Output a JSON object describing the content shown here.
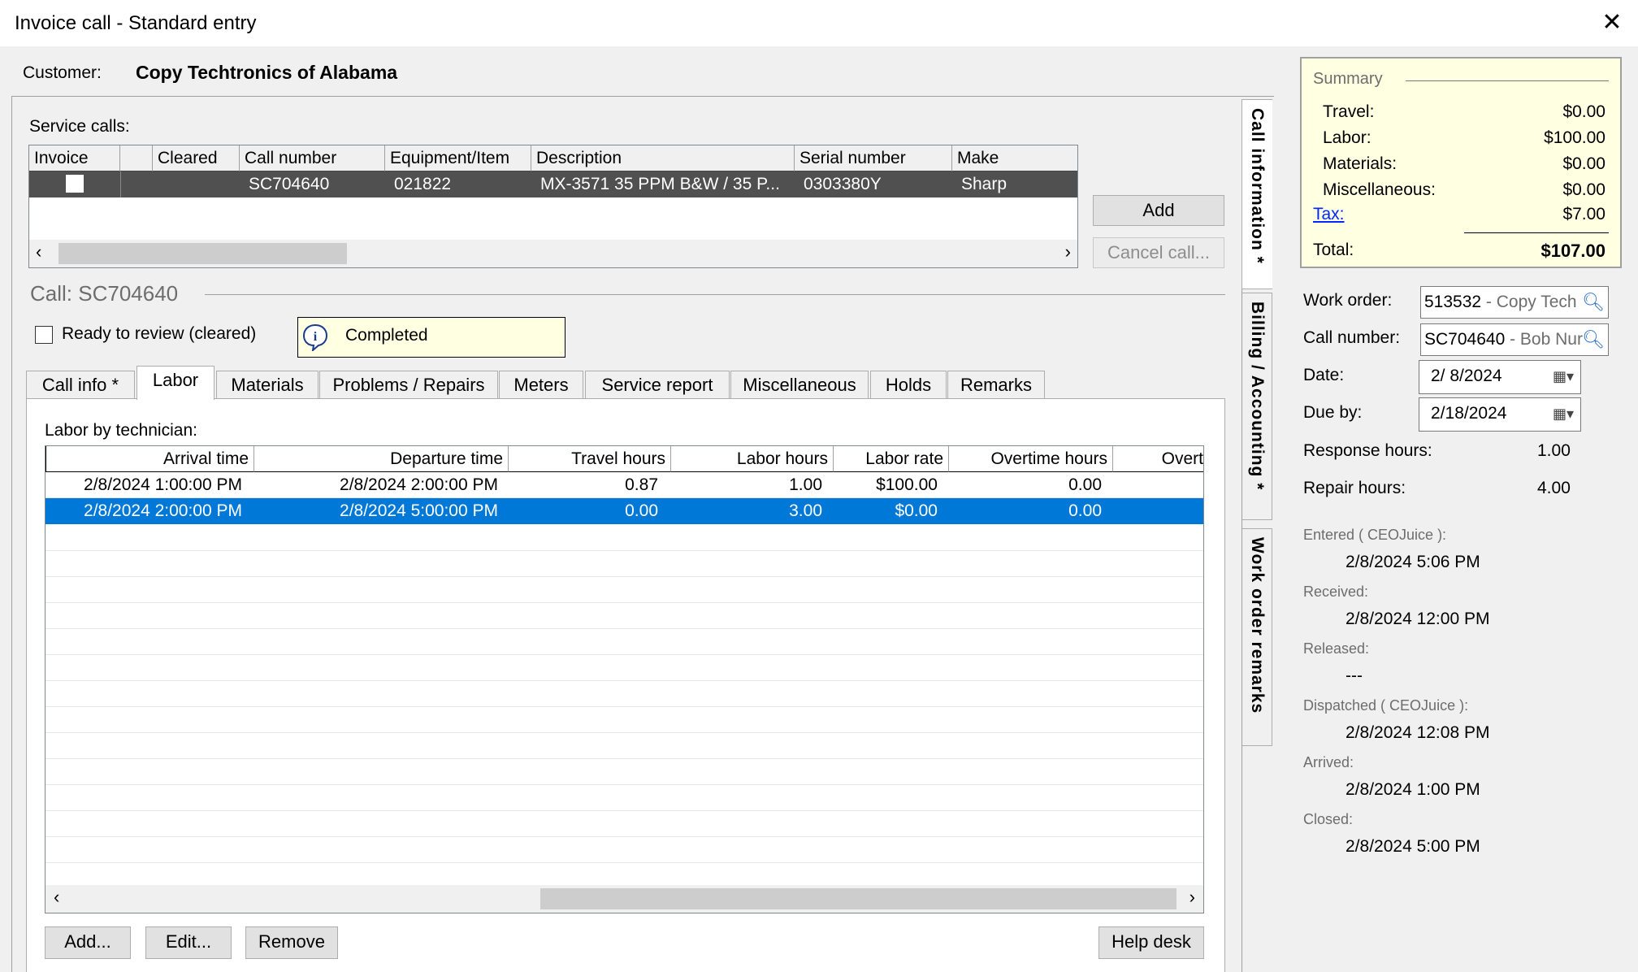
{
  "window": {
    "title": "Invoice call - Standard entry",
    "close": "✕"
  },
  "customer": {
    "label": "Customer:",
    "name": "Copy Techtronics of Alabama"
  },
  "service_calls": {
    "label": "Service calls:",
    "columns": [
      "Invoice",
      "",
      "Cleared",
      "Call number",
      "Equipment/Item",
      "Description",
      "Serial number",
      "Make"
    ],
    "row": {
      "call_number": "SC704640",
      "equipment": "021822",
      "description": "MX-3571 35 PPM B&W / 35 P...",
      "serial": "0303380Y",
      "make": "Sharp"
    },
    "add": "Add",
    "cancel": "Cancel call..."
  },
  "call": {
    "title": "Call: SC704640",
    "ready_label": "Ready to review (cleared)",
    "status": "Completed"
  },
  "tabs": [
    "Call info *",
    "Labor",
    "Materials",
    "Problems / Repairs",
    "Meters",
    "Service report",
    "Miscellaneous",
    "Holds",
    "Remarks"
  ],
  "active_tab": "Labor",
  "side_tabs": [
    "Call information *",
    "Billing / Accounting *",
    "Work order remarks"
  ],
  "labor": {
    "label": "Labor by technician:",
    "columns": [
      "Arrival time",
      "Departure time",
      "Travel hours",
      "Labor hours",
      "Labor rate",
      "Overtime hours",
      "Overt"
    ],
    "rows": [
      [
        "2/8/2024 1:00:00 PM",
        "2/8/2024 2:00:00 PM",
        "0.87",
        "1.00",
        "$100.00",
        "0.00"
      ],
      [
        "2/8/2024 2:00:00 PM",
        "2/8/2024 5:00:00 PM",
        "0.00",
        "3.00",
        "$0.00",
        "0.00"
      ]
    ],
    "buttons": {
      "add": "Add...",
      "edit": "Edit...",
      "remove": "Remove",
      "help": "Help desk"
    }
  },
  "summary": {
    "title": "Summary",
    "travel_label": "Travel:",
    "travel": "$0.00",
    "labor_label": "Labor:",
    "labor": "$100.00",
    "materials_label": "Materials:",
    "materials": "$0.00",
    "misc_label": "Miscellaneous:",
    "misc": "$0.00",
    "tax_label": "Tax:",
    "tax": "$7.00",
    "total_label": "Total:",
    "total": "$107.00"
  },
  "details": {
    "work_order_label": "Work order:",
    "work_order": "513532",
    "work_order_desc": " - Copy Tech",
    "call_number_label": "Call number:",
    "call_number": "SC704640",
    "call_number_desc": " - Bob Nur",
    "date_label": "Date:",
    "date": "2/ 8/2024",
    "due_label": "Due by:",
    "due": "2/18/2024",
    "response_label": "Response hours:",
    "response": "1.00",
    "repair_label": "Repair hours:",
    "repair": "4.00"
  },
  "timeline": [
    {
      "label": "Entered ( CEOJuice ):",
      "value": "2/8/2024 5:06 PM"
    },
    {
      "label": "Received:",
      "value": "2/8/2024 12:00 PM"
    },
    {
      "label": "Released:",
      "value": "---"
    },
    {
      "label": "Dispatched ( CEOJuice ):",
      "value": "2/8/2024 12:08 PM"
    },
    {
      "label": "Arrived:",
      "value": "2/8/2024 1:00 PM"
    },
    {
      "label": "Closed:",
      "value": "2/8/2024 5:00 PM"
    }
  ],
  "colors": {
    "selection": "#0078d7",
    "dark_row": "#505050",
    "summary_bg": "#ffffe1",
    "status_bg": "#ffffe1"
  }
}
